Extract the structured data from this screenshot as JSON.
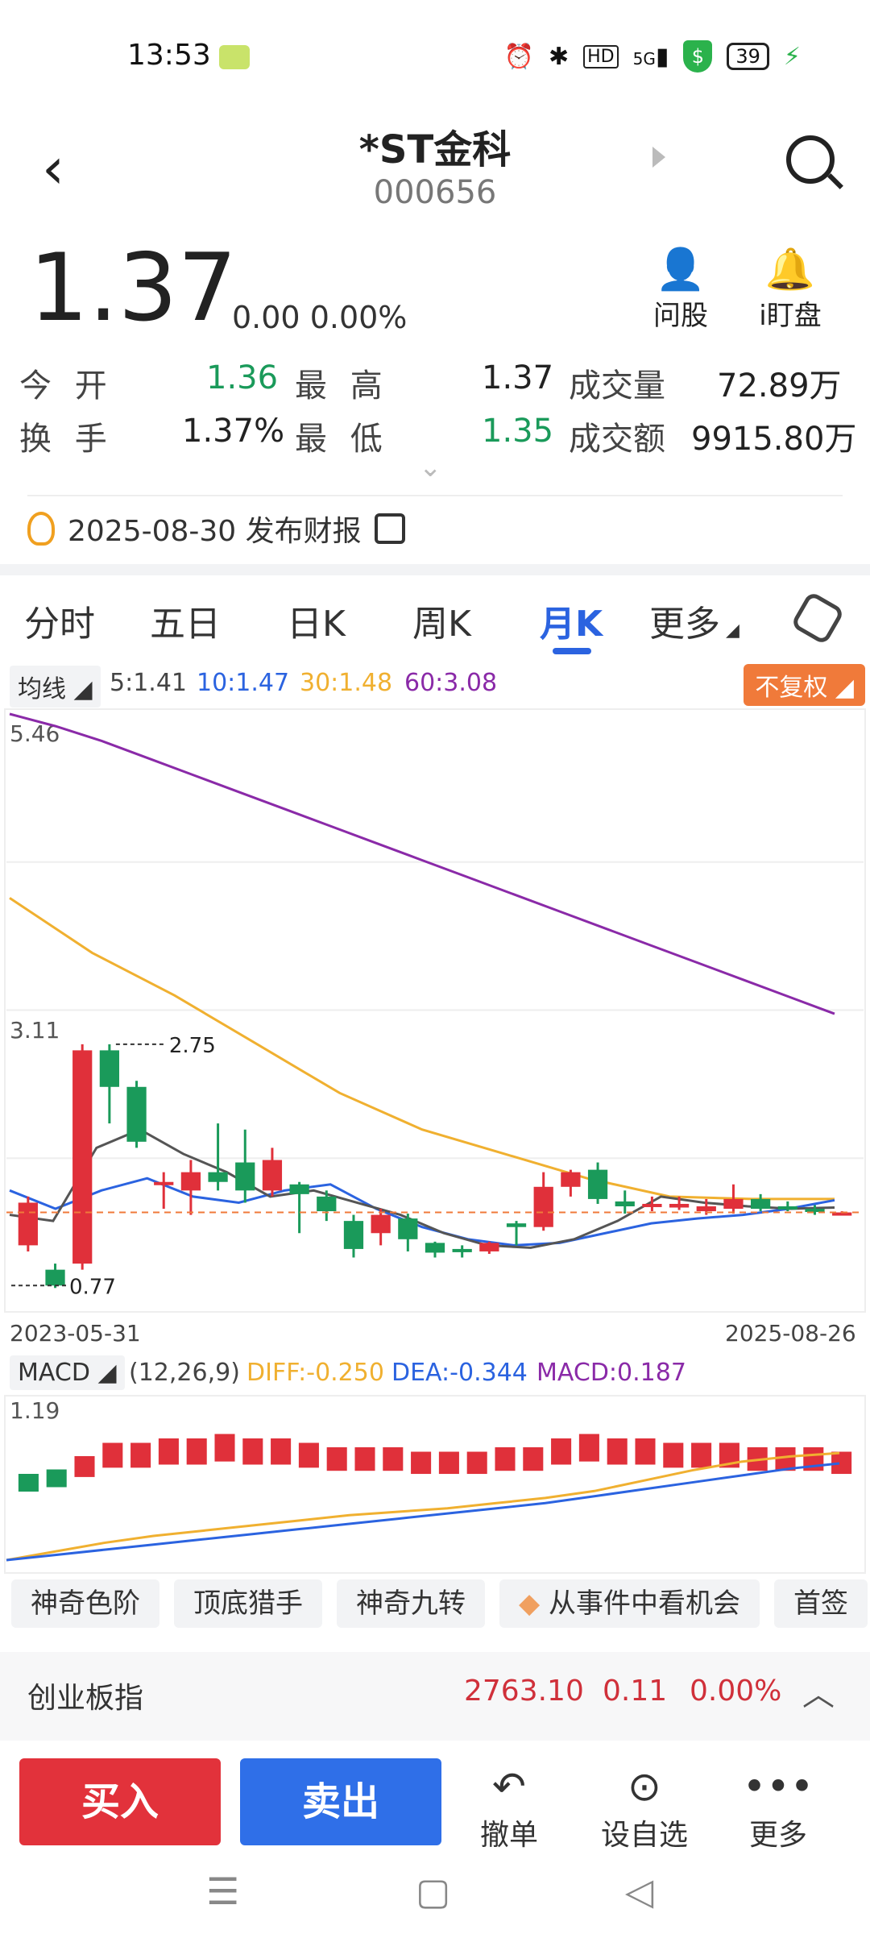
{
  "status": {
    "time": "13:53",
    "battery": "39",
    "signal": "5G",
    "hd": "HD"
  },
  "nav": {
    "title": "*ST金科",
    "code": "000656"
  },
  "quote": {
    "price": "1.37",
    "change": "0.00 0.00%",
    "btn_ask": "问股",
    "btn_watch": "i盯盘",
    "open_label": "今 开",
    "open": "1.36",
    "high_label": "最 高",
    "high": "1.37",
    "vol_label": "成交量",
    "vol": "72.89万",
    "turnover_label": "换 手",
    "turnover": "1.37%",
    "low_label": "最 低",
    "low": "1.35",
    "amount_label": "成交额",
    "amount": "9915.80万"
  },
  "notice": {
    "text": "2025-08-30 发布财报"
  },
  "tabs": [
    "分时",
    "五日",
    "日K",
    "周K",
    "月K",
    "更多"
  ],
  "ma_bar": {
    "label": "均线",
    "ma5": "5:1.41",
    "ma10": "10:1.47",
    "ma30": "30:1.48",
    "ma60": "60:3.08",
    "adjust": "不复权"
  },
  "macd_bar": {
    "label": "MACD",
    "params": "(12,26,9)",
    "diff": "DIFF:-0.250",
    "dea": "DEA:-0.344",
    "macd": "MACD:0.187"
  },
  "colors": {
    "up": "#e0303a",
    "down": "#1a9a5a",
    "ma5": "#555555",
    "ma10": "#2b63e0",
    "ma30": "#f0b030",
    "ma60": "#8a2aa8"
  },
  "chart_data": [
    {
      "type": "candlestick",
      "y_top_label": "5.46",
      "y_mid_label": "3.11",
      "ylim": [
        0.6,
        5.46
      ],
      "start_date": "2023-05-31",
      "end_date": "2025-08-26",
      "annotations": [
        {
          "label": "2.75",
          "value": 2.75
        },
        {
          "label": "0.77",
          "value": 0.77
        }
      ],
      "candles": [
        [
          1.1,
          1.45,
          1.05,
          1.5
        ],
        [
          0.9,
          0.77,
          0.75,
          0.95
        ],
        [
          0.95,
          2.7,
          0.9,
          2.75
        ],
        [
          2.7,
          2.4,
          2.1,
          2.75
        ],
        [
          2.4,
          1.95,
          1.9,
          2.45
        ],
        [
          1.6,
          1.62,
          1.4,
          1.7
        ],
        [
          1.55,
          1.7,
          1.35,
          1.8
        ],
        [
          1.7,
          1.62,
          1.55,
          2.1
        ],
        [
          1.78,
          1.55,
          1.45,
          2.05
        ],
        [
          1.55,
          1.8,
          1.5,
          1.9
        ],
        [
          1.6,
          1.52,
          1.2,
          1.62
        ],
        [
          1.5,
          1.38,
          1.3,
          1.55
        ],
        [
          1.3,
          1.07,
          1.0,
          1.35
        ],
        [
          1.2,
          1.35,
          1.1,
          1.4
        ],
        [
          1.32,
          1.15,
          1.05,
          1.36
        ],
        [
          1.12,
          1.04,
          1.0,
          1.13
        ],
        [
          1.07,
          1.05,
          1.0,
          1.1
        ],
        [
          1.05,
          1.12,
          1.03,
          1.13
        ],
        [
          1.28,
          1.25,
          1.1,
          1.3
        ],
        [
          1.25,
          1.58,
          1.22,
          1.7
        ],
        [
          1.58,
          1.7,
          1.5,
          1.72
        ],
        [
          1.72,
          1.48,
          1.44,
          1.78
        ],
        [
          1.46,
          1.42,
          1.36,
          1.55
        ],
        [
          1.42,
          1.44,
          1.38,
          1.5
        ],
        [
          1.41,
          1.44,
          1.39,
          1.5
        ],
        [
          1.38,
          1.42,
          1.35,
          1.48
        ],
        [
          1.4,
          1.48,
          1.36,
          1.6
        ],
        [
          1.48,
          1.4,
          1.38,
          1.52
        ],
        [
          1.42,
          1.41,
          1.38,
          1.46
        ],
        [
          1.4,
          1.38,
          1.35,
          1.43
        ],
        [
          1.36,
          1.37,
          1.35,
          1.38
        ]
      ],
      "series": [
        {
          "name": "60",
          "values": [
            5.46,
            5.36,
            5.24,
            5.1,
            4.96,
            4.82,
            4.68,
            4.54,
            4.4,
            4.26,
            4.12,
            3.98,
            3.84,
            3.7,
            3.56,
            3.42,
            3.28,
            3.14,
            3.0
          ]
        },
        {
          "name": "30",
          "values": [
            3.95,
            3.5,
            3.15,
            2.75,
            2.35,
            2.05,
            1.85,
            1.65,
            1.5,
            1.48,
            1.48
          ]
        },
        {
          "name": "10",
          "values": [
            1.55,
            1.4,
            1.55,
            1.65,
            1.5,
            1.45,
            1.55,
            1.6,
            1.4,
            1.25,
            1.15,
            1.1,
            1.12,
            1.2,
            1.28,
            1.32,
            1.35,
            1.4,
            1.47
          ]
        },
        {
          "name": "5",
          "values": [
            1.35,
            1.3,
            1.9,
            2.05,
            1.85,
            1.7,
            1.5,
            1.55,
            1.45,
            1.35,
            1.2,
            1.1,
            1.08,
            1.15,
            1.3,
            1.5,
            1.45,
            1.42,
            1.4,
            1.41
          ]
        }
      ],
      "ref_price": 1.37
    },
    {
      "type": "bar",
      "name": "MACD",
      "y_top_label": "1.19",
      "values": [
        0.02,
        0.03,
        0.06,
        0.09,
        0.09,
        0.1,
        0.1,
        0.11,
        0.1,
        0.1,
        0.09,
        0.08,
        0.08,
        0.08,
        0.07,
        0.07,
        0.07,
        0.08,
        0.08,
        0.1,
        0.11,
        0.1,
        0.1,
        0.09,
        0.09,
        0.09,
        0.08,
        0.08,
        0.08,
        0.07
      ],
      "diff": [
        0.0,
        0.05,
        0.1,
        0.14,
        0.17,
        0.2,
        0.23,
        0.26,
        0.28,
        0.3,
        0.33,
        0.36,
        0.4,
        0.46,
        0.52,
        0.57,
        0.6,
        0.62
      ],
      "dea": [
        0.0,
        0.03,
        0.06,
        0.09,
        0.12,
        0.15,
        0.18,
        0.21,
        0.24,
        0.27,
        0.3,
        0.33,
        0.37,
        0.41,
        0.45,
        0.49,
        0.53,
        0.56
      ]
    }
  ],
  "pills": [
    "神奇色阶",
    "顶底猎手",
    "神奇九转",
    "从事件中看机会",
    "首签"
  ],
  "index": {
    "name": "创业板指",
    "value": "2763.10",
    "change": "0.11",
    "pct": "0.00%"
  },
  "actions": {
    "buy": "买入",
    "sell": "卖出",
    "cancel": "撤单",
    "watchlist": "设自选",
    "more": "更多"
  }
}
